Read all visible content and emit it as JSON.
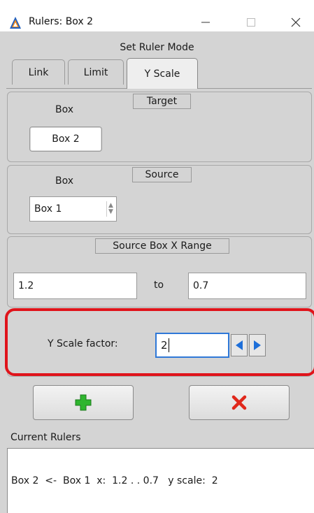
{
  "window": {
    "title": "Rulers: Box 2",
    "controls": {
      "minimize": "—",
      "maximize": "☐",
      "close": "✕"
    }
  },
  "mode_label": "Set Ruler Mode",
  "tabs": [
    {
      "label": "Link",
      "selected": false
    },
    {
      "label": "Limit",
      "selected": false
    },
    {
      "label": "Y Scale",
      "selected": true
    }
  ],
  "target": {
    "title": "Target",
    "box_label": "Box",
    "box_value": "Box 2"
  },
  "source": {
    "title": "Source",
    "box_label": "Box",
    "box_value": "Box 1"
  },
  "range": {
    "title": "Source Box X Range",
    "from": "1.2",
    "to_label": "to",
    "to": "0.7"
  },
  "scale": {
    "label": "Y Scale factor:",
    "value": "2"
  },
  "actions": {
    "add_icon": "plus-icon",
    "delete_icon": "x-icon",
    "add_color": "#2fb52f",
    "delete_color": "#e0281b"
  },
  "current_rulers": {
    "label": "Current Rulers",
    "items": [
      "Box 2  <-  Box 1  x:  1.2 . . 0.7   y scale:  2"
    ]
  },
  "highlight_color": "#e0141b"
}
